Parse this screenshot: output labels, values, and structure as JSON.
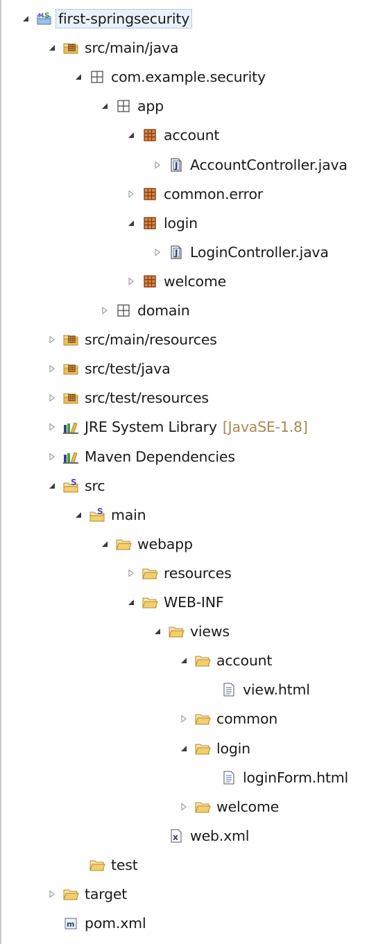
{
  "explorer": {
    "nodes": [
      {
        "label": "first-springsecurity",
        "depth": 0,
        "twisty": "expanded",
        "icon": "project-icon",
        "selected": true
      },
      {
        "label": "src/main/java",
        "depth": 1,
        "twisty": "expanded",
        "icon": "source-folder-icon"
      },
      {
        "label": "com.example.security",
        "depth": 2,
        "twisty": "expanded",
        "icon": "empty-package-icon"
      },
      {
        "label": "app",
        "depth": 3,
        "twisty": "expanded",
        "icon": "empty-package-icon"
      },
      {
        "label": "account",
        "depth": 4,
        "twisty": "expanded",
        "icon": "package-icon"
      },
      {
        "label": "AccountController.java",
        "depth": 5,
        "twisty": "collapsed",
        "icon": "java-file-icon"
      },
      {
        "label": "common.error",
        "depth": 4,
        "twisty": "collapsed",
        "icon": "package-icon"
      },
      {
        "label": "login",
        "depth": 4,
        "twisty": "expanded",
        "icon": "package-icon"
      },
      {
        "label": "LoginController.java",
        "depth": 5,
        "twisty": "collapsed",
        "icon": "java-file-icon"
      },
      {
        "label": "welcome",
        "depth": 4,
        "twisty": "collapsed",
        "icon": "package-icon"
      },
      {
        "label": "domain",
        "depth": 3,
        "twisty": "collapsed",
        "icon": "empty-package-icon"
      },
      {
        "label": "src/main/resources",
        "depth": 1,
        "twisty": "collapsed",
        "icon": "source-folder-icon"
      },
      {
        "label": "src/test/java",
        "depth": 1,
        "twisty": "collapsed",
        "icon": "source-folder-icon"
      },
      {
        "label": "src/test/resources",
        "depth": 1,
        "twisty": "collapsed",
        "icon": "source-folder-icon"
      },
      {
        "label": "JRE System Library",
        "decoration": "[JavaSE-1.8]",
        "depth": 1,
        "twisty": "collapsed",
        "icon": "library-icon"
      },
      {
        "label": "Maven Dependencies",
        "depth": 1,
        "twisty": "collapsed",
        "icon": "library-icon"
      },
      {
        "label": "src",
        "depth": 1,
        "twisty": "expanded",
        "icon": "spring-folder-icon"
      },
      {
        "label": "main",
        "depth": 2,
        "twisty": "expanded",
        "icon": "spring-folder-icon"
      },
      {
        "label": "webapp",
        "depth": 3,
        "twisty": "expanded",
        "icon": "folder-icon"
      },
      {
        "label": "resources",
        "depth": 4,
        "twisty": "collapsed",
        "icon": "folder-icon"
      },
      {
        "label": "WEB-INF",
        "depth": 4,
        "twisty": "expanded",
        "icon": "folder-icon"
      },
      {
        "label": "views",
        "depth": 5,
        "twisty": "expanded",
        "icon": "folder-icon"
      },
      {
        "label": "account",
        "depth": 6,
        "twisty": "expanded",
        "icon": "folder-icon"
      },
      {
        "label": "view.html",
        "depth": 7,
        "twisty": "none",
        "icon": "html-file-icon"
      },
      {
        "label": "common",
        "depth": 6,
        "twisty": "collapsed",
        "icon": "folder-icon"
      },
      {
        "label": "login",
        "depth": 6,
        "twisty": "expanded",
        "icon": "folder-icon"
      },
      {
        "label": "loginForm.html",
        "depth": 7,
        "twisty": "none",
        "icon": "html-file-icon"
      },
      {
        "label": "welcome",
        "depth": 6,
        "twisty": "collapsed",
        "icon": "folder-icon"
      },
      {
        "label": "web.xml",
        "depth": 5,
        "twisty": "none",
        "icon": "xml-file-icon"
      },
      {
        "label": "test",
        "depth": 2,
        "twisty": "none",
        "icon": "folder-icon"
      },
      {
        "label": "target",
        "depth": 1,
        "twisty": "collapsed",
        "icon": "folder-icon"
      },
      {
        "label": "pom.xml",
        "depth": 1,
        "twisty": "none",
        "icon": "maven-pom-icon"
      }
    ],
    "colors": {
      "decoration": "#a9884f",
      "folder": "#e7c470",
      "package": "#b5651d",
      "spring": "#3f9f3f",
      "selection": "#e9f1fc"
    }
  }
}
